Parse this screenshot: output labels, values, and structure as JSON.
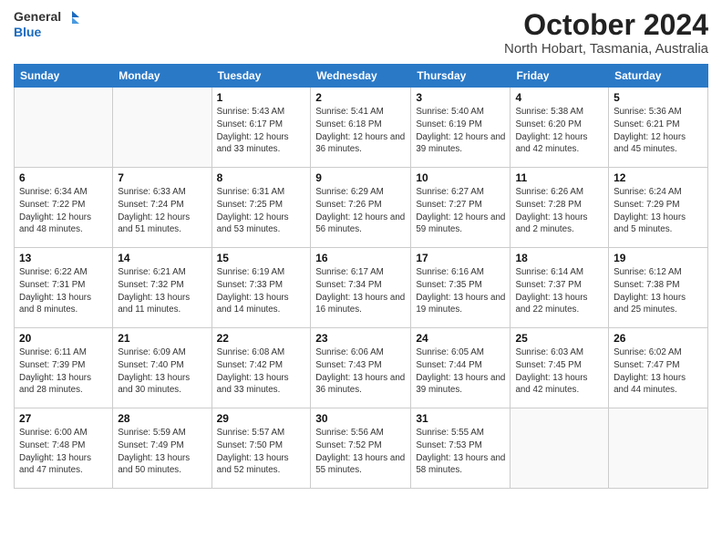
{
  "logo": {
    "general": "General",
    "blue": "Blue"
  },
  "header": {
    "title": "October 2024",
    "subtitle": "North Hobart, Tasmania, Australia"
  },
  "columns": [
    "Sunday",
    "Monday",
    "Tuesday",
    "Wednesday",
    "Thursday",
    "Friday",
    "Saturday"
  ],
  "weeks": [
    [
      {
        "day": "",
        "info": ""
      },
      {
        "day": "",
        "info": ""
      },
      {
        "day": "1",
        "info": "Sunrise: 5:43 AM\nSunset: 6:17 PM\nDaylight: 12 hours and 33 minutes."
      },
      {
        "day": "2",
        "info": "Sunrise: 5:41 AM\nSunset: 6:18 PM\nDaylight: 12 hours and 36 minutes."
      },
      {
        "day": "3",
        "info": "Sunrise: 5:40 AM\nSunset: 6:19 PM\nDaylight: 12 hours and 39 minutes."
      },
      {
        "day": "4",
        "info": "Sunrise: 5:38 AM\nSunset: 6:20 PM\nDaylight: 12 hours and 42 minutes."
      },
      {
        "day": "5",
        "info": "Sunrise: 5:36 AM\nSunset: 6:21 PM\nDaylight: 12 hours and 45 minutes."
      }
    ],
    [
      {
        "day": "6",
        "info": "Sunrise: 6:34 AM\nSunset: 7:22 PM\nDaylight: 12 hours and 48 minutes."
      },
      {
        "day": "7",
        "info": "Sunrise: 6:33 AM\nSunset: 7:24 PM\nDaylight: 12 hours and 51 minutes."
      },
      {
        "day": "8",
        "info": "Sunrise: 6:31 AM\nSunset: 7:25 PM\nDaylight: 12 hours and 53 minutes."
      },
      {
        "day": "9",
        "info": "Sunrise: 6:29 AM\nSunset: 7:26 PM\nDaylight: 12 hours and 56 minutes."
      },
      {
        "day": "10",
        "info": "Sunrise: 6:27 AM\nSunset: 7:27 PM\nDaylight: 12 hours and 59 minutes."
      },
      {
        "day": "11",
        "info": "Sunrise: 6:26 AM\nSunset: 7:28 PM\nDaylight: 13 hours and 2 minutes."
      },
      {
        "day": "12",
        "info": "Sunrise: 6:24 AM\nSunset: 7:29 PM\nDaylight: 13 hours and 5 minutes."
      }
    ],
    [
      {
        "day": "13",
        "info": "Sunrise: 6:22 AM\nSunset: 7:31 PM\nDaylight: 13 hours and 8 minutes."
      },
      {
        "day": "14",
        "info": "Sunrise: 6:21 AM\nSunset: 7:32 PM\nDaylight: 13 hours and 11 minutes."
      },
      {
        "day": "15",
        "info": "Sunrise: 6:19 AM\nSunset: 7:33 PM\nDaylight: 13 hours and 14 minutes."
      },
      {
        "day": "16",
        "info": "Sunrise: 6:17 AM\nSunset: 7:34 PM\nDaylight: 13 hours and 16 minutes."
      },
      {
        "day": "17",
        "info": "Sunrise: 6:16 AM\nSunset: 7:35 PM\nDaylight: 13 hours and 19 minutes."
      },
      {
        "day": "18",
        "info": "Sunrise: 6:14 AM\nSunset: 7:37 PM\nDaylight: 13 hours and 22 minutes."
      },
      {
        "day": "19",
        "info": "Sunrise: 6:12 AM\nSunset: 7:38 PM\nDaylight: 13 hours and 25 minutes."
      }
    ],
    [
      {
        "day": "20",
        "info": "Sunrise: 6:11 AM\nSunset: 7:39 PM\nDaylight: 13 hours and 28 minutes."
      },
      {
        "day": "21",
        "info": "Sunrise: 6:09 AM\nSunset: 7:40 PM\nDaylight: 13 hours and 30 minutes."
      },
      {
        "day": "22",
        "info": "Sunrise: 6:08 AM\nSunset: 7:42 PM\nDaylight: 13 hours and 33 minutes."
      },
      {
        "day": "23",
        "info": "Sunrise: 6:06 AM\nSunset: 7:43 PM\nDaylight: 13 hours and 36 minutes."
      },
      {
        "day": "24",
        "info": "Sunrise: 6:05 AM\nSunset: 7:44 PM\nDaylight: 13 hours and 39 minutes."
      },
      {
        "day": "25",
        "info": "Sunrise: 6:03 AM\nSunset: 7:45 PM\nDaylight: 13 hours and 42 minutes."
      },
      {
        "day": "26",
        "info": "Sunrise: 6:02 AM\nSunset: 7:47 PM\nDaylight: 13 hours and 44 minutes."
      }
    ],
    [
      {
        "day": "27",
        "info": "Sunrise: 6:00 AM\nSunset: 7:48 PM\nDaylight: 13 hours and 47 minutes."
      },
      {
        "day": "28",
        "info": "Sunrise: 5:59 AM\nSunset: 7:49 PM\nDaylight: 13 hours and 50 minutes."
      },
      {
        "day": "29",
        "info": "Sunrise: 5:57 AM\nSunset: 7:50 PM\nDaylight: 13 hours and 52 minutes."
      },
      {
        "day": "30",
        "info": "Sunrise: 5:56 AM\nSunset: 7:52 PM\nDaylight: 13 hours and 55 minutes."
      },
      {
        "day": "31",
        "info": "Sunrise: 5:55 AM\nSunset: 7:53 PM\nDaylight: 13 hours and 58 minutes."
      },
      {
        "day": "",
        "info": ""
      },
      {
        "day": "",
        "info": ""
      }
    ]
  ]
}
